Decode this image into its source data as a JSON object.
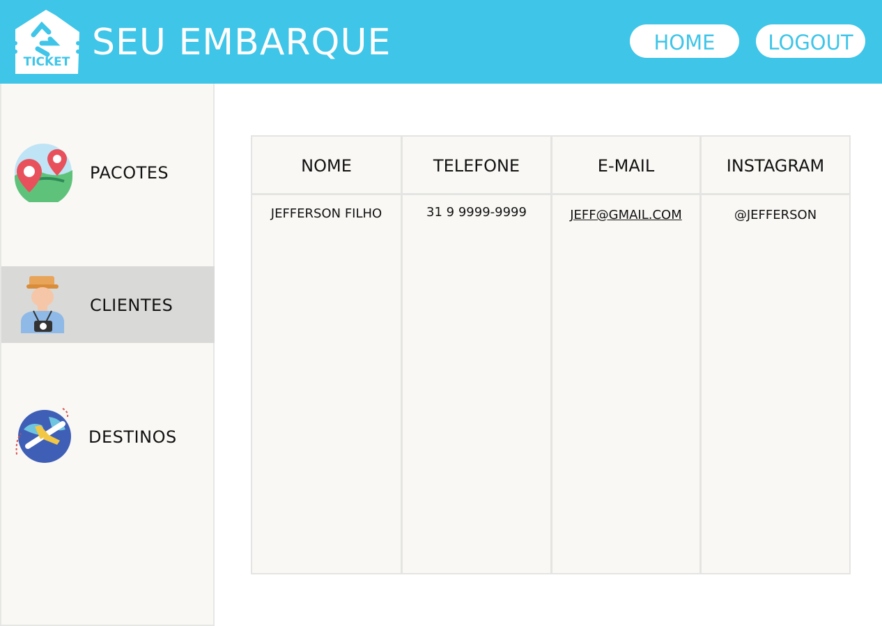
{
  "header": {
    "logo_text": "TICKET",
    "title": "SEU EMBARQUE",
    "home_label": "HOME",
    "logout_label": "LOGOUT"
  },
  "sidebar": {
    "items": [
      {
        "label": "PACOTES",
        "icon": "map-pin-icon",
        "active": false
      },
      {
        "label": "CLIENTES",
        "icon": "tourist-icon",
        "active": true
      },
      {
        "label": "DESTINOS",
        "icon": "globe-plane-icon",
        "active": false
      }
    ]
  },
  "table": {
    "columns": [
      "NOME",
      "TELEFONE",
      "E-MAIL",
      "INSTAGRAM"
    ],
    "rows": [
      [
        "JEFFERSON FILHO",
        "31 9 9999-9999",
        "JEFF@GMAIL.COM",
        "@JEFFERSON"
      ]
    ]
  },
  "colors": {
    "header_bg": "#3ec5e8",
    "sidebar_bg": "#f9f8f5",
    "active_item_bg": "#d9d9d7",
    "table_bg": "#f9f8f5"
  }
}
